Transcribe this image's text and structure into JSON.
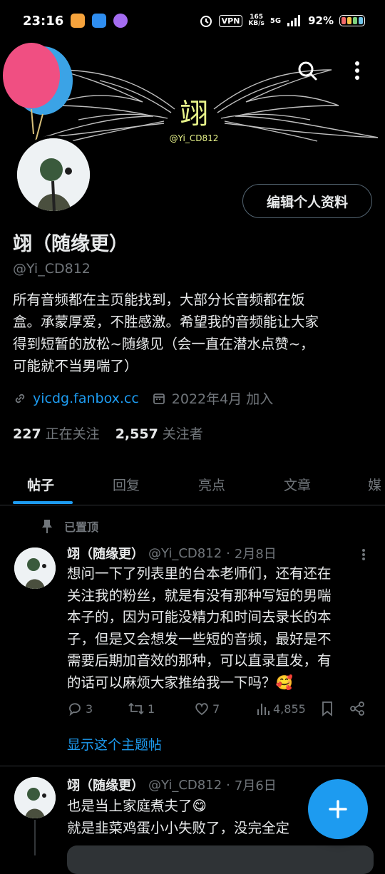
{
  "status_bar": {
    "time": "23:16",
    "vpn": "VPN",
    "speed_value": "165",
    "speed_unit": "KB/s",
    "network": "5G",
    "battery_percent": "92%",
    "app_icon_colors": [
      "#f6a33c",
      "#2f8ef0",
      "#a46cf0"
    ]
  },
  "banner": {
    "logo_text": "翊",
    "logo_sub": "@Yi_CD812",
    "balloon_colors": [
      "#f04f82",
      "#3ba3e6"
    ]
  },
  "profile": {
    "edit_button": "编辑个人资料",
    "display_name": "翊（随缘更）",
    "handle": "@Yi_CD812",
    "bio_lines": [
      "所有音频都在主页能找到，大部分长音频都在饭",
      "盒。承蒙厚爱，不胜感激。希望我的音频能让大家",
      "得到短暂的放松~随缘见（会一直在潜水点赞~，",
      "可能就不当男喘了）"
    ],
    "website": "yicdg.fanbox.cc",
    "joined": "2022年4月 加入",
    "following_count": "227",
    "following_label": "正在关注",
    "followers_count": "2,557",
    "followers_label": "关注者"
  },
  "tabs": [
    "帖子",
    "回复",
    "亮点",
    "文章",
    "媒"
  ],
  "pinned_label": "已置顶",
  "tweets": [
    {
      "name": "翊（随缘更）",
      "handle": "@Yi_CD812",
      "dot": "·",
      "date": "2月8日",
      "lines": [
        "想问一下了列表里的台本老师们，还有还在",
        "关注我的粉丝，就是有没有那种写短的男喘",
        "本子的，因为可能没精力和时间去录长的本",
        "子，但是又会想发一些短的音频，最好是不",
        "需要后期加音效的那种，可以直录直发，有",
        "的话可以麻烦大家推给我一下吗？🥰"
      ],
      "replies": "3",
      "retweets": "1",
      "likes": "7",
      "views": "4,855",
      "thread_link": "显示这个主题帖"
    },
    {
      "name": "翊（随缘更）",
      "handle": "@Yi_CD812",
      "dot": "·",
      "date": "7月6日",
      "lines": [
        "也是当上家庭煮夫了😋",
        "就是韭菜鸡蛋小小失败了，没完全定"
      ]
    }
  ],
  "accent_color": "#1d9bf0"
}
